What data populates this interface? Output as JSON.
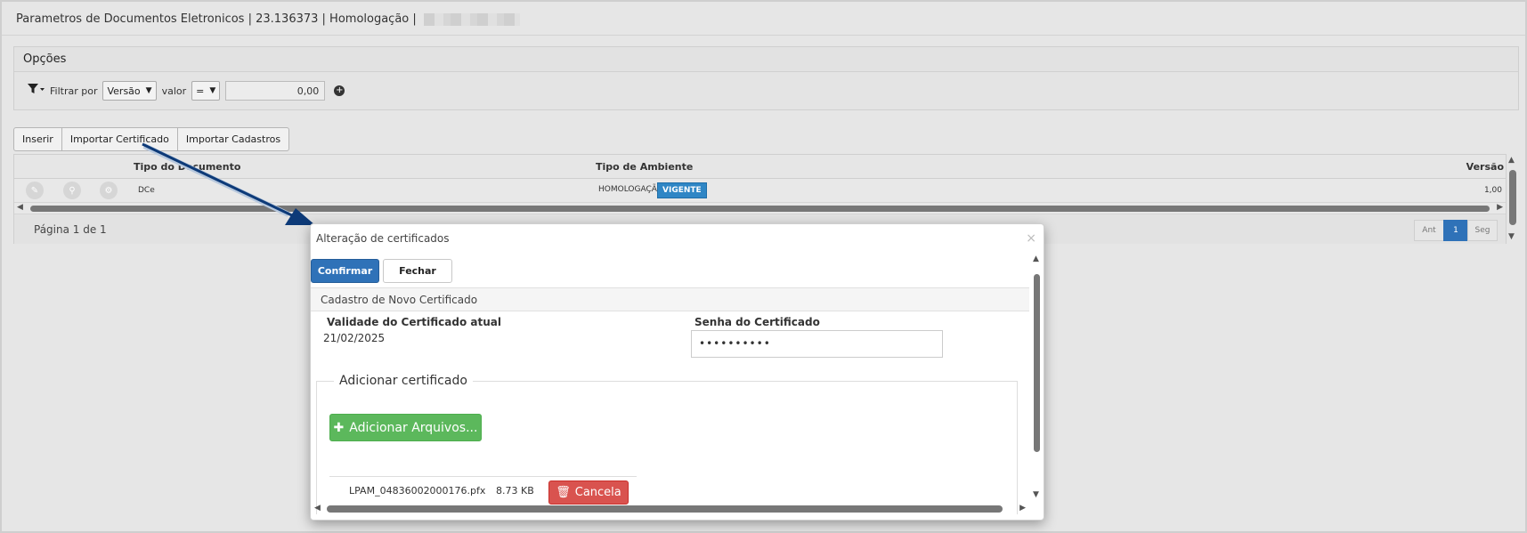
{
  "header": {
    "title": "Parametros de Documentos Eletronicos | 23.136373 | Homologação |"
  },
  "options": {
    "title": "Opções",
    "filter_label": "Filtrar por",
    "field_select": "Versão",
    "value_label": "valor",
    "operator_select": "=",
    "value_input": "0,00"
  },
  "toolbar": {
    "insert": "Inserir",
    "import_cert": "Importar Certificado",
    "import_cadastros": "Importar Cadastros"
  },
  "grid": {
    "columns": [
      "Tipo do Documento",
      "Tipo de Ambiente",
      "Versão"
    ],
    "rows": [
      {
        "tipo_documento": "DCe",
        "ambiente": "HOMOLOGAÇÃO",
        "status": "VIGENTE",
        "versao": "1,00"
      }
    ],
    "pager_label": "Página 1 de 1",
    "pager": {
      "prev": "Ant",
      "current": "1",
      "next": "Seg"
    }
  },
  "modal": {
    "title": "Alteração de certificados",
    "close_glyph": "×",
    "confirm": "Confirmar",
    "close": "Fechar",
    "section": "Cadastro de Novo Certificado",
    "validity_label": "Validade do Certificado atual",
    "validity_value": "21/02/2025",
    "password_label": "Senha do Certificado",
    "password_value": "••••••••••",
    "fieldset_legend": "Adicionar certificado",
    "add_files": "Adicionar Arquivos...",
    "file": {
      "name": "LPAM_04836002000176.pfx",
      "size": "8.73 KB",
      "cancel": "Cancela"
    }
  },
  "colors": {
    "primary": "#2f72b8",
    "success": "#5cb85c",
    "danger": "#d9534f",
    "badge": "#2f86c5"
  }
}
